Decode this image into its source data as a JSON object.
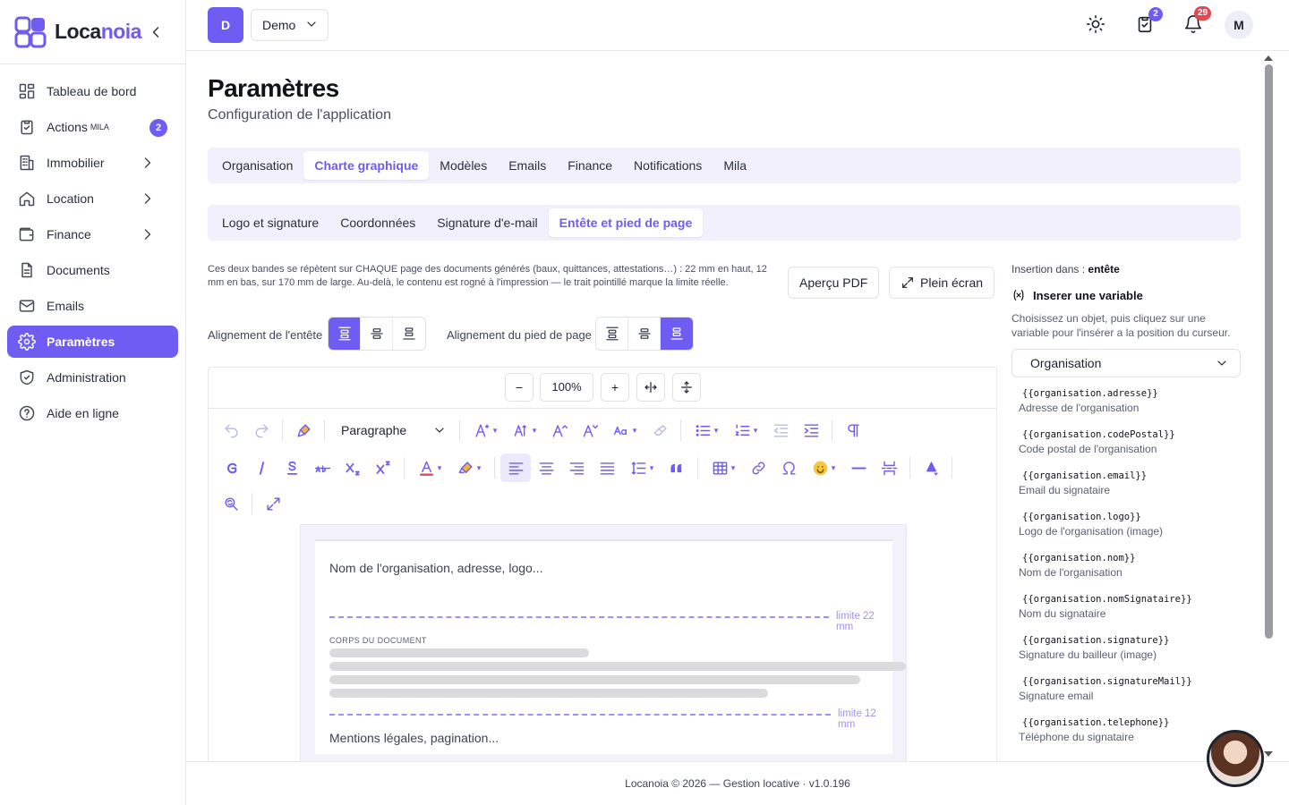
{
  "brand": {
    "name_main": "Loca",
    "name_accent": "noia"
  },
  "sidebar": {
    "items": [
      {
        "label": "Tableau de bord",
        "icon": "dashboard-icon"
      },
      {
        "label": "Actions",
        "sup": "MILA",
        "badge": "2",
        "icon": "clipboard-check-icon"
      },
      {
        "label": "Immobilier",
        "icon": "building-icon"
      },
      {
        "label": "Location",
        "icon": "home-icon"
      },
      {
        "label": "Finance",
        "icon": "wallet-icon"
      },
      {
        "label": "Documents",
        "icon": "document-icon"
      },
      {
        "label": "Emails",
        "icon": "mail-icon"
      },
      {
        "label": "Paramètres",
        "icon": "gear-icon"
      },
      {
        "label": "Administration",
        "icon": "shield-icon"
      },
      {
        "label": "Aide en ligne",
        "icon": "help-icon"
      }
    ]
  },
  "topbar": {
    "workspace_initial": "D",
    "workspace_name": "Demo",
    "tasks_badge": "2",
    "notifications_badge": "29",
    "user_initial": "M"
  },
  "page": {
    "title": "Paramètres",
    "subtitle": "Configuration de l'application"
  },
  "tabs": [
    "Organisation",
    "Charte graphique",
    "Modèles",
    "Emails",
    "Finance",
    "Notifications",
    "Mila"
  ],
  "subtabs": [
    "Logo et signature",
    "Coordonnées",
    "Signature d'e-mail",
    "Entête et pied de page"
  ],
  "intro": "Ces deux bandes se répètent sur CHAQUE page des documents générés (baux, quittances, attestations…) : 22 mm en haut, 12 mm en bas, sur 170 mm de large. Au-delà, le contenu est rogné à l'impression — le trait pointillé marque la limite réelle.",
  "buttons": {
    "preview": "Aperçu PDF",
    "fullscreen": "Plein écran"
  },
  "alignment": {
    "header_label": "Alignement de l'entête",
    "footer_label": "Alignement du pied de page"
  },
  "editor": {
    "zoom": "100%",
    "zoom_out": "−",
    "zoom_in": "+",
    "paragraph": "Paragraphe",
    "header_placeholder": "Nom de l'organisation, adresse, logo...",
    "header_limit": "limite 22 mm",
    "body_label": "CORPS DU DOCUMENT",
    "footer_limit": "limite 12 mm",
    "footer_placeholder": "Mentions légales, pagination..."
  },
  "insertion": {
    "prefix": "Insertion dans :",
    "target": "entête",
    "title": "Inserer une variable",
    "help": "Choisissez un objet, puis cliquez sur une variable pour l'insérer a la position du curseur.",
    "object": "Organisation",
    "variables": [
      {
        "code": "{{organisation.adresse}}",
        "desc": "Adresse de l'organisation"
      },
      {
        "code": "{{organisation.codePostal}}",
        "desc": "Code postal de l'organisation"
      },
      {
        "code": "{{organisation.email}}",
        "desc": "Email du signataire"
      },
      {
        "code": "{{organisation.logo}}",
        "desc": "Logo de l'organisation (image)"
      },
      {
        "code": "{{organisation.nom}}",
        "desc": "Nom de l'organisation"
      },
      {
        "code": "{{organisation.nomSignataire}}",
        "desc": "Nom du signataire"
      },
      {
        "code": "{{organisation.signature}}",
        "desc": "Signature du bailleur (image)"
      },
      {
        "code": "{{organisation.signatureMail}}",
        "desc": "Signature email"
      },
      {
        "code": "{{organisation.telephone}}",
        "desc": "Téléphone du signataire"
      }
    ]
  },
  "footer": "Locanoia © 2026 — Gestion locative · v1.0.196",
  "colors": {
    "accent": "#6f5cf2",
    "notification_badge": "#e0494f"
  }
}
